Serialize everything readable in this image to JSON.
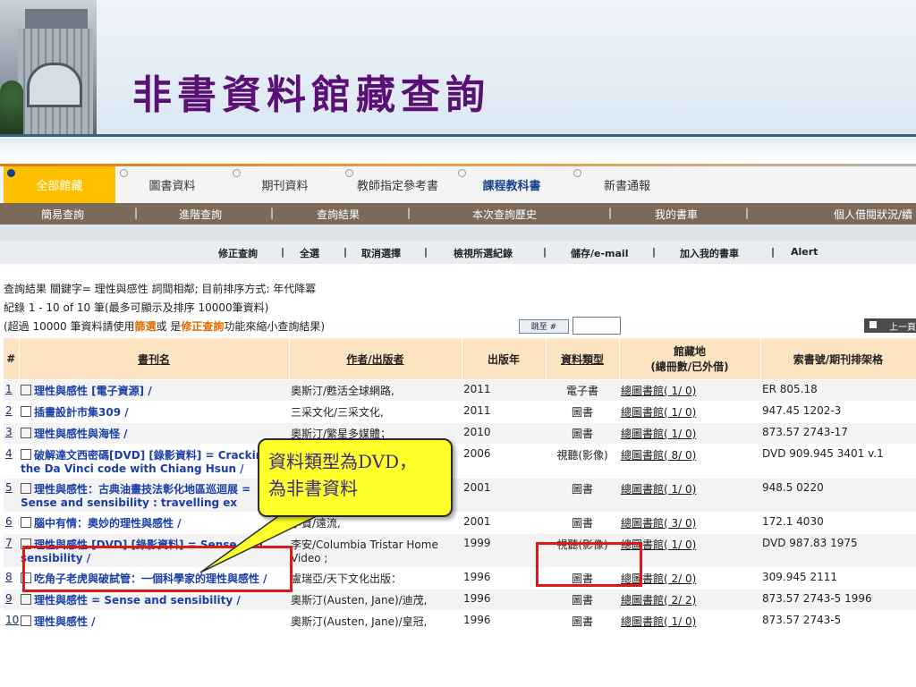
{
  "slide": {
    "title": "非書資料館藏查詢"
  },
  "tabs": [
    {
      "label": "全部館藏",
      "active": true
    },
    {
      "label": "圖書資料"
    },
    {
      "label": "期刊資料"
    },
    {
      "label": "教師指定參考書"
    },
    {
      "label": "課程教科書",
      "bold": true
    },
    {
      "label": "新書通報"
    }
  ],
  "subnav": [
    "簡易查詢",
    "|",
    "進階查詢",
    "|",
    "查詢結果",
    "|",
    "本次查詢歷史",
    "|",
    "我的書車",
    "|",
    "個人借閱狀況/續"
  ],
  "toolbar": [
    "修正查詢",
    "|",
    "全選",
    "|",
    "取消選擇",
    "|",
    "檢視所選紀錄",
    "|",
    "儲存/e-mail",
    "|",
    "加入我的書車",
    "|",
    "Alert"
  ],
  "info": {
    "line1": "查詢結果 關鍵字= 理性與感性 詞間相鄰; 目前排序方式: 年代降冪",
    "line2": "紀錄 1 - 10 of 10 筆(最多可顯示及排序 10000筆資料)",
    "line3_pre": "(超過 10000 筆資料請使用",
    "line3_filter": "篩選",
    "line3_mid": "或 是",
    "line3_modify": "修正查詢",
    "line3_post": "功能來縮小查詢結果)",
    "jump_label": "跳至 #",
    "prev_label": "上一頁"
  },
  "table": {
    "headers": {
      "num": "#",
      "title": "書刊名",
      "author": "作者/出版者",
      "year": "出版年",
      "type": "資料類型",
      "loc1": "館藏地",
      "loc2": "(總冊數/已外借)",
      "call": "索書號/期刊排架格"
    },
    "rows": [
      {
        "n": "1",
        "title": "理性與感性 [電子資源] /",
        "author": "奧斯汀/甦活全球網路,",
        "year": "2011",
        "type": "電子書",
        "loc": "總圖書館( 1/ 0)",
        "call": "ER 805.18"
      },
      {
        "n": "2",
        "title": "插畫設計市集309 /",
        "author": "三采文化/三采文化,",
        "year": "2011",
        "type": "圖書",
        "loc": "總圖書館( 1/ 0)",
        "call": "947.45 1202-3"
      },
      {
        "n": "3",
        "title": "理性與感性與海怪 /",
        "author": "奧斯汀/繁星多媒體；",
        "year": "2010",
        "type": "圖書",
        "loc": "總圖書館( 1/ 0)",
        "call": "873.57 2743-17"
      },
      {
        "n": "4",
        "title": "破解達文西密碼[DVD] [錄影資料] = Cracking the Da Vinci code with Chiang Hsun /",
        "author": "",
        "year": "2006",
        "type": "視聽(影像)",
        "loc": "總圖書館( 8/ 0)",
        "call": "DVD 909.945 3401 v.1"
      },
      {
        "n": "5",
        "title": "理性與感性：古典油畫技法彰化地區巡迴展 = Sense and sensibility : travelling ex",
        "author": "",
        "year": "2001",
        "type": "圖書",
        "loc": "總圖書館( 1/ 0)",
        "call": "948.5 0220"
      },
      {
        "n": "6",
        "title": "腦中有情：奧妙的理性與感性 /",
        "author": "李寶/遠流,",
        "year": "2001",
        "type": "圖書",
        "loc": "總圖書館( 3/ 0)",
        "call": "172.1 4030"
      },
      {
        "n": "7",
        "title": "理性與感性 [DVD] [錄影資料] = Sense and sensibility /",
        "author": "李安/Columbia Tristar Home Video ;",
        "year": "1999",
        "type": "視聽(影像)",
        "loc": "總圖書館( 1/ 0)",
        "call": "DVD 987.83 1975"
      },
      {
        "n": "8",
        "title": "吃角子老虎與破試管：一個科學家的理性與感性 /",
        "author": "盧瑞亞/天下文化出版：",
        "year": "1996",
        "type": "圖書",
        "loc": "總圖書館( 2/ 0)",
        "call": "309.945 2111"
      },
      {
        "n": "9",
        "title": "理性與感性 = Sense and sensibility /",
        "author": "奧斯汀(Austen, Jane)/迪茂,",
        "year": "1996",
        "type": "圖書",
        "loc": "總圖書館( 2/ 2)",
        "call": "873.57 2743-5 1996"
      },
      {
        "n": "10",
        "title": "理性與感性 /",
        "author": "奧斯汀(Austen, Jane)/皇冠,",
        "year": "1996",
        "type": "圖書",
        "loc": "總圖書館( 1/ 0)",
        "call": "873.57 2743-5"
      }
    ]
  },
  "callout": {
    "line1": "資料類型為DVD，",
    "line2": "為非書資料"
  },
  "colors": {
    "title": "#5b1075",
    "tab_active": "#ffc000",
    "link": "#1a3fa8",
    "highlight": "#e01818",
    "callout": "#ffff2a"
  }
}
